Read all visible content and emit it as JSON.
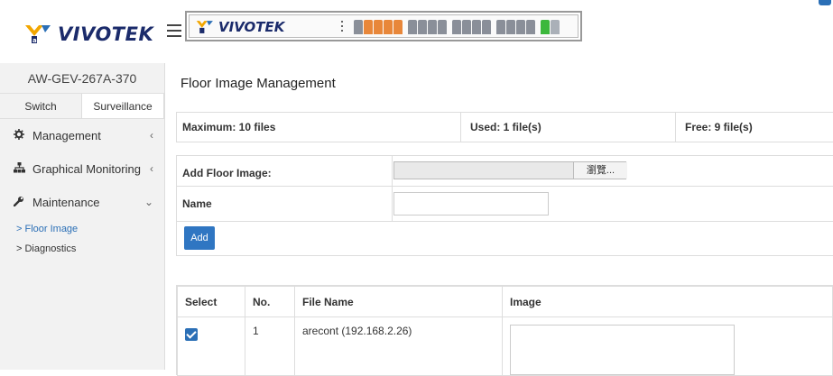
{
  "brand": {
    "name": "VIVOTEK",
    "accent": "#1b2b6b",
    "primary": "#2f76c2"
  },
  "device": {
    "model": "AW-GEV-267A-370"
  },
  "sidebar": {
    "tabs": [
      {
        "label": "Switch"
      },
      {
        "label": "Surveillance"
      }
    ],
    "menu": [
      {
        "label": "Management",
        "icon": "gear-icon",
        "chevron": "‹"
      },
      {
        "label": "Graphical Monitoring",
        "icon": "network-icon",
        "chevron": "‹"
      },
      {
        "label": "Maintenance",
        "icon": "wrench-icon",
        "chevron": "⌄"
      }
    ],
    "submenu": [
      {
        "label": "> Floor Image"
      },
      {
        "label": "> Diagnostics"
      }
    ]
  },
  "main": {
    "title": "Floor Image Management",
    "quota": {
      "maximum": "Maximum: 10 files",
      "used": "Used: 1 file(s)",
      "free": "Free: 9 file(s)"
    },
    "form": {
      "add_label": "Add Floor Image:",
      "browse_label": "瀏覽...",
      "name_label": "Name",
      "name_value": "",
      "add_button": "Add"
    },
    "table": {
      "headers": [
        "Select",
        "No.",
        "File Name",
        "Image"
      ],
      "rows": [
        {
          "checked": true,
          "no": "1",
          "file_name": "arecont (192.168.2.26)"
        }
      ]
    }
  }
}
